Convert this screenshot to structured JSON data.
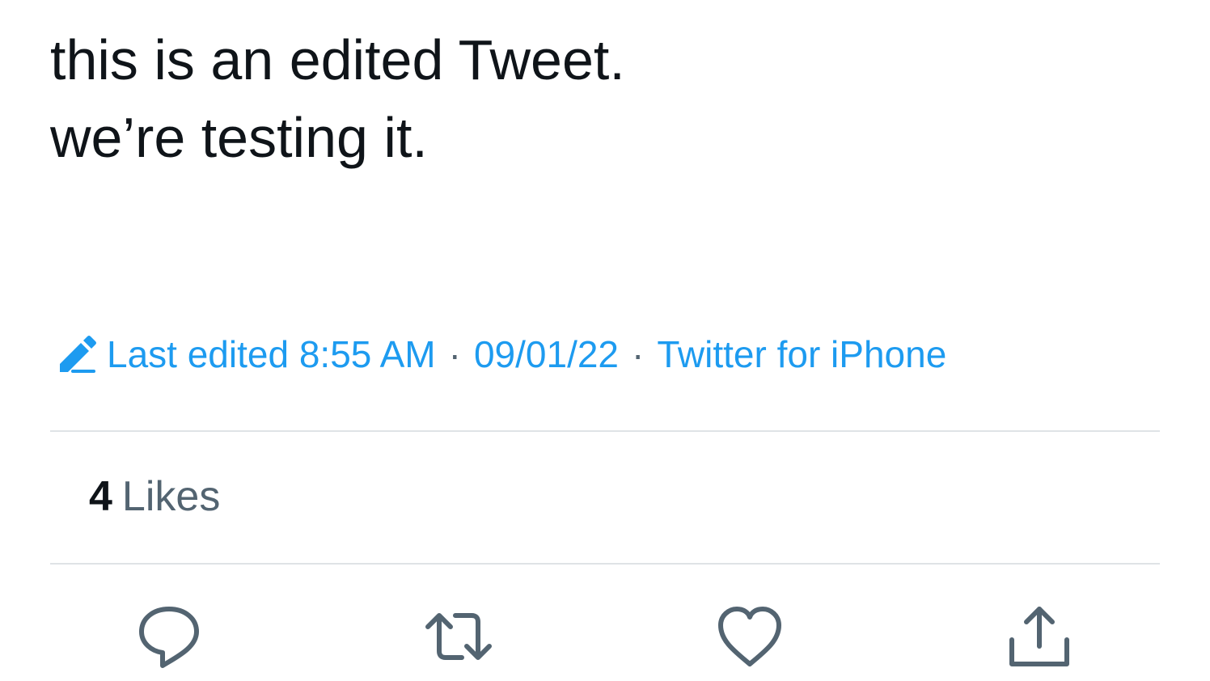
{
  "tweet": {
    "text_lines": [
      "this is an edited Tweet.",
      "we’re testing it."
    ]
  },
  "meta": {
    "edited_label": "Last edited 8:55 AM",
    "separator": "·",
    "date": "09/01/22",
    "source": "Twitter for iPhone",
    "icon": "pencil-icon"
  },
  "stats": {
    "likes_count": "4",
    "likes_label": "Likes"
  },
  "actions": {
    "reply_icon": "reply-icon",
    "retweet_icon": "retweet-icon",
    "like_icon": "heart-icon",
    "share_icon": "share-icon"
  },
  "colors": {
    "text": "#0f1419",
    "accent": "#1d9bf0",
    "secondary": "#536471",
    "divider": "#dfe3e6"
  }
}
